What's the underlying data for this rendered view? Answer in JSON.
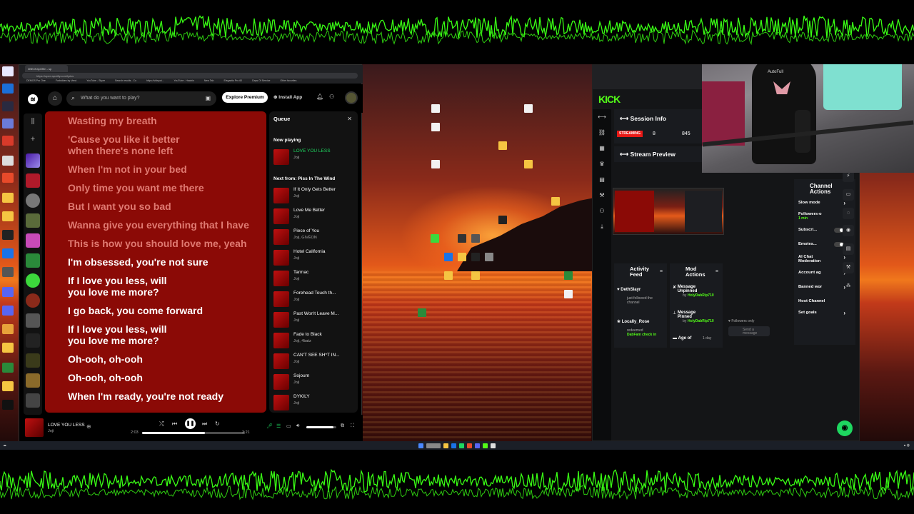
{
  "spotify": {
    "browser_tabs": [
      "3BE4S4pOffm - sp",
      "",
      "",
      "",
      "",
      "",
      ""
    ],
    "url": "https://open.spotify.com/lyrics",
    "bookmarks": [
      "DEMOS Pro One",
      "Forbidden by Vend",
      "YouTube - Skyer",
      "Search results - Co",
      "https://vidspot...",
      "YouTube - Hawkin",
      "New Tab",
      "Elegantis Pro 60",
      "Days Of Service",
      "Other favorites"
    ],
    "search_placeholder": "What do you want to play?",
    "explore_premium": "Explore Premium",
    "install_app": "Install App",
    "lyrics": [
      {
        "text": "Wasting my breath",
        "active": false
      },
      {
        "text": "'Cause you like it better\nwhen there's none left",
        "active": false
      },
      {
        "text": "When I'm not in your bed",
        "active": false
      },
      {
        "text": "Only time you want me there",
        "active": false
      },
      {
        "text": "But I want you so bad",
        "active": false
      },
      {
        "text": "Wanna give you everything that I have",
        "active": false
      },
      {
        "text": "This is how you should love me, yeah",
        "active": false
      },
      {
        "text": "I'm obsessed, you're not sure",
        "active": true
      },
      {
        "text": "If I love you less, will\nyou love me more?",
        "active": true
      },
      {
        "text": "I go back, you come forward",
        "active": true
      },
      {
        "text": "If I love you less, will\nyou love me more?",
        "active": true
      },
      {
        "text": "Oh-ooh, oh-ooh",
        "active": true
      },
      {
        "text": "Oh-ooh, oh-ooh",
        "active": true
      },
      {
        "text": "When I'm ready, you're not ready",
        "active": true
      }
    ],
    "queue": {
      "title": "Queue",
      "now_playing_label": "Now playing",
      "now_playing": {
        "title": "LOVE YOU LESS",
        "artist": "Joji"
      },
      "next_from_label": "Next from: Piss In The Wind",
      "items": [
        {
          "title": "If It Only Gets Better",
          "artist": "Joji"
        },
        {
          "title": "Love Me Better",
          "artist": "Joji"
        },
        {
          "title": "Piece of You",
          "artist": "Joji, GIVĒON"
        },
        {
          "title": "Hotel California",
          "artist": "Joji"
        },
        {
          "title": "Tarmac",
          "artist": "Joji"
        },
        {
          "title": "Forehead Touch th...",
          "artist": "Joji"
        },
        {
          "title": "Past Won't Leave M...",
          "artist": "Joji"
        },
        {
          "title": "Fade to Black",
          "artist": "Joji, 4batz"
        },
        {
          "title": "CAN'T SEE SH*T IN...",
          "artist": "Joji"
        },
        {
          "title": "Sojourn",
          "artist": "Joji"
        },
        {
          "title": "DYKILY",
          "artist": "Joji"
        }
      ]
    },
    "player": {
      "title": "LOVE YOU LESS",
      "artist": "Joji",
      "elapsed": "2:03",
      "duration": "3:21",
      "progress": 0.61,
      "volume": 0.9
    }
  },
  "kick": {
    "logo": "KICK",
    "session_info": "Session Info",
    "streaming_badge": "STREAMING",
    "stat_1": "8",
    "stat_2": "845",
    "stream_preview": "Stream Preview",
    "activity_feed": {
      "title": "Activity\nFeed",
      "entries": [
        {
          "name": "DethSlayr",
          "time": "3\nhours\nago",
          "detail": "just followed the\nchannel"
        },
        {
          "name": "Locally_Rose",
          "time": "hou\ne",
          "detail": "redeemed",
          "extra": "DabFam check in"
        }
      ]
    },
    "mod_actions": {
      "title": "Mod\nActions",
      "entries": [
        {
          "name": "Message\nUnpinned",
          "time": "4\nminute\nago",
          "by": "by",
          "mod": "HolyDabRip710"
        },
        {
          "name": "Message\nPinned",
          "time": "3\nhours\nago",
          "by": "by",
          "mod": "HolyDabRip710"
        },
        {
          "name": "Age of",
          "time": "1 day"
        }
      ]
    },
    "chat": {
      "followers_only": "Followers only",
      "placeholder": "Send a\nmessage"
    },
    "channel_actions": {
      "title": "Channel\nActions",
      "rows": [
        {
          "label": "Slow mode",
          "sub": ""
        },
        {
          "label": "Followers-o",
          "sub": "1 min"
        },
        {
          "label": "Subscri...",
          "sub": ""
        },
        {
          "label": "Emotes...",
          "sub": ""
        },
        {
          "label": "AI Chat\nModeration",
          "sub": ""
        },
        {
          "label": "Account ag",
          "sub": ""
        },
        {
          "label": "Banned wor",
          "sub": ""
        },
        {
          "label": "Host Channel",
          "sub": ""
        },
        {
          "label": "Set goals",
          "sub": ""
        }
      ]
    }
  },
  "webcam": {
    "chair_brand": "AutoFull"
  },
  "colors": {
    "spotify_green": "#1ed760",
    "kick_green": "#53fc18",
    "lyrics_bg": "#8b0a06",
    "wave_green": "#39ff14"
  }
}
